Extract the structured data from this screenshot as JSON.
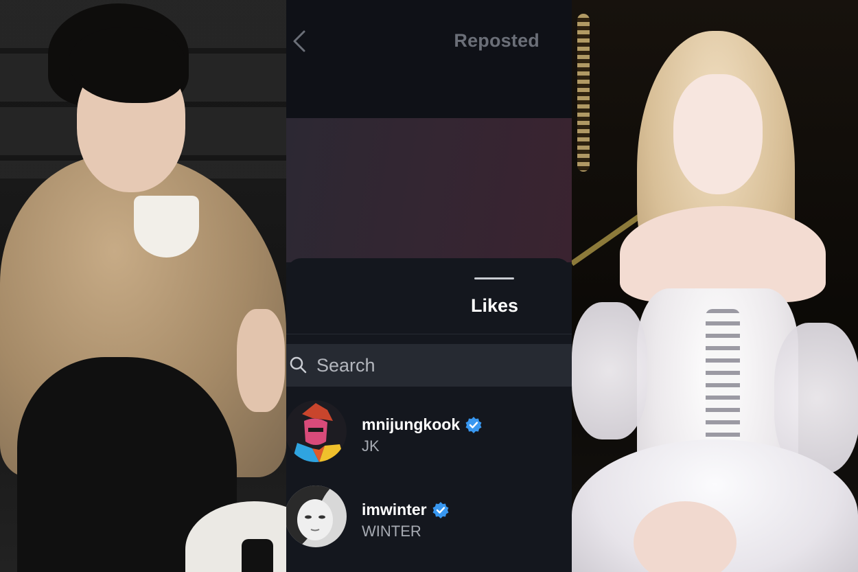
{
  "left_photo": {
    "description_icon": "portrait-photo"
  },
  "right_photo": {
    "description_icon": "portrait-photo"
  },
  "app": {
    "back_icon": "chevron-left-icon",
    "header": {
      "title": "Reposted"
    },
    "tabs": [
      {
        "label": "Likes",
        "active": true
      }
    ],
    "search": {
      "placeholder": "Search",
      "value": ""
    },
    "users": [
      {
        "username": "mnijungkook",
        "full_name": "JK",
        "verified": true,
        "avatar_icon": "cartoon-avatar"
      },
      {
        "username": "imwinter",
        "full_name": "WINTER",
        "verified": true,
        "avatar_icon": "photo-avatar"
      }
    ],
    "colors": {
      "verified": "#3897f0",
      "background": "#14171e",
      "search_bg": "#262a32"
    }
  }
}
